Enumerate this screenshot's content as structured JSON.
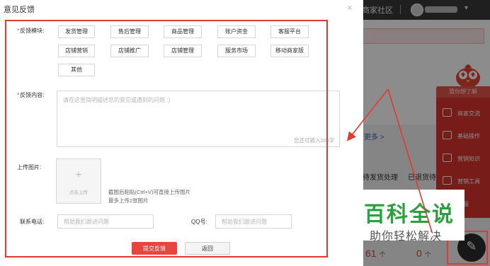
{
  "background": {
    "community_link": "商家社区",
    "more_link": "更多 >",
    "pending_label": "待发货处理",
    "returned_label": "已退货待",
    "count_1": "61",
    "count_2": "0",
    "count_unit": "个",
    "side_panel": {
      "header": "猜你想了解",
      "items": [
        {
          "label": "商家交流",
          "icon": "chat-icon"
        },
        {
          "label": "基础操作",
          "icon": "settings-icon"
        },
        {
          "label": "营销知识",
          "icon": "document-icon"
        },
        {
          "label": "营销工具",
          "icon": "tools-icon"
        },
        {
          "label": "客服",
          "icon": "service-icon"
        }
      ]
    },
    "feedback_icon": "edit-icon"
  },
  "watermark": {
    "title": "百科全说",
    "subtitle": "助你轻松解决"
  },
  "modal": {
    "title": "意见反馈",
    "close_icon": "close-icon",
    "category_label": "反馈模块:",
    "categories": [
      "发货管理",
      "售后管理",
      "商品管理",
      "账户资金",
      "客服平台",
      "店铺营销",
      "店铺推广",
      "店铺管理",
      "服务市场",
      "移动商家版",
      "其他"
    ],
    "content_label": "反馈内容:",
    "content_placeholder": "请在这里简明描述您的意见或遇到的问题 :)",
    "char_counter": "您还可输入200字",
    "image_label": "上传图片:",
    "upload_label": "点击上传",
    "upload_hint_1": "截图后粘贴(Ctrl+V)可直接上传图片",
    "upload_hint_2": "最多上传2张图片",
    "phone_label": "联系电话:",
    "phone_placeholder": "帮助我们跟进问题",
    "qq_label": "QQ号:",
    "qq_placeholder": "帮助我们跟进问题",
    "submit_label": "提交反馈",
    "back_label": "返回"
  },
  "colors": {
    "accent_red": "#e8453c",
    "annotation_red": "#e23a32",
    "watermark_green": "#2f9e3f"
  }
}
